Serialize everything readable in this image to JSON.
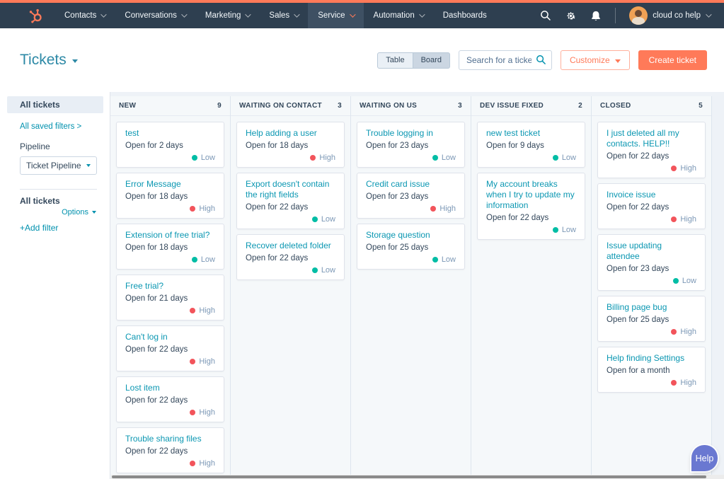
{
  "nav": {
    "items": [
      {
        "label": "Contacts",
        "caret": true,
        "active": false
      },
      {
        "label": "Conversations",
        "caret": true,
        "active": false
      },
      {
        "label": "Marketing",
        "caret": true,
        "active": false
      },
      {
        "label": "Sales",
        "caret": true,
        "active": false
      },
      {
        "label": "Service",
        "caret": true,
        "active": true
      },
      {
        "label": "Automation",
        "caret": true,
        "active": false
      },
      {
        "label": "Dashboards",
        "caret": false,
        "active": false
      }
    ],
    "account_name": "cloud co help"
  },
  "header": {
    "title": "Tickets",
    "view_toggle": [
      {
        "label": "Table",
        "selected": false
      },
      {
        "label": "Board",
        "selected": true
      }
    ],
    "search_placeholder": "Search for a ticket",
    "customize_label": "Customize",
    "create_ticket_label": "Create ticket"
  },
  "sidebar": {
    "selected_view": "All tickets",
    "saved_filters_link": "All saved filters >",
    "pipeline_label": "Pipeline",
    "pipeline_value": "Ticket Pipeline",
    "filter_group_label": "All tickets",
    "options_label": "Options",
    "add_filter_label": "+Add filter"
  },
  "board": {
    "columns": [
      {
        "name": "NEW",
        "count": 9,
        "partial_card": true,
        "cards": [
          {
            "title": "test",
            "status": "Open for 2 days",
            "priority": "Low"
          },
          {
            "title": "Error Message",
            "status": "Open for 18 days",
            "priority": "High"
          },
          {
            "title": "Extension of free trial?",
            "status": "Open for 18 days",
            "priority": "Low"
          },
          {
            "title": "Free trial?",
            "status": "Open for 21 days",
            "priority": "High"
          },
          {
            "title": "Can't log in",
            "status": "Open for 22 days",
            "priority": "High"
          },
          {
            "title": "Lost item",
            "status": "Open for 22 days",
            "priority": "High"
          },
          {
            "title": "Trouble sharing files",
            "status": "Open for 22 days",
            "priority": "High"
          }
        ]
      },
      {
        "name": "WAITING ON CONTACT",
        "count": 3,
        "partial_card": false,
        "cards": [
          {
            "title": "Help adding a user",
            "status": "Open for 18 days",
            "priority": "High"
          },
          {
            "title": "Export doesn't contain the right fields",
            "status": "Open for 22 days",
            "priority": "Low"
          },
          {
            "title": "Recover deleted folder",
            "status": "Open for 22 days",
            "priority": "Low"
          }
        ]
      },
      {
        "name": "WAITING ON US",
        "count": 3,
        "partial_card": false,
        "cards": [
          {
            "title": "Trouble logging in",
            "status": "Open for 23 days",
            "priority": "Low"
          },
          {
            "title": "Credit card issue",
            "status": "Open for 23 days",
            "priority": "High"
          },
          {
            "title": "Storage question",
            "status": "Open for 25 days",
            "priority": "Low"
          }
        ]
      },
      {
        "name": "DEV ISSUE FIXED",
        "count": 2,
        "partial_card": false,
        "cards": [
          {
            "title": "new test ticket",
            "status": "Open for 9 days",
            "priority": "Low"
          },
          {
            "title": "My account breaks when I try to update my information",
            "status": "Open for 22 days",
            "priority": "Low"
          }
        ]
      },
      {
        "name": "CLOSED",
        "count": 5,
        "partial_card": false,
        "cards": [
          {
            "title": "I just deleted all my contacts. HELP!!",
            "status": "Open for 22 days",
            "priority": "High"
          },
          {
            "title": "Invoice issue",
            "status": "Open for 22 days",
            "priority": "High"
          },
          {
            "title": "Issue updating attendee",
            "status": "Open for 23 days",
            "priority": "Low"
          },
          {
            "title": "Billing page bug",
            "status": "Open for 25 days",
            "priority": "High"
          },
          {
            "title": "Help finding Settings",
            "status": "Open for a month",
            "priority": "High"
          }
        ]
      }
    ]
  },
  "help_button_label": "Help",
  "colors": {
    "accent_orange": "#ff7a59",
    "nav_bg": "#2e3f50",
    "link_teal": "#0091ae",
    "title_teal": "#2d89a6",
    "text_dark": "#33475b",
    "text_muted": "#7c98b6",
    "board_bg": "#f5f8fa",
    "help_purple": "#6a78d1",
    "priority": {
      "Low": "#00bda5",
      "High": "#f2545b"
    }
  }
}
